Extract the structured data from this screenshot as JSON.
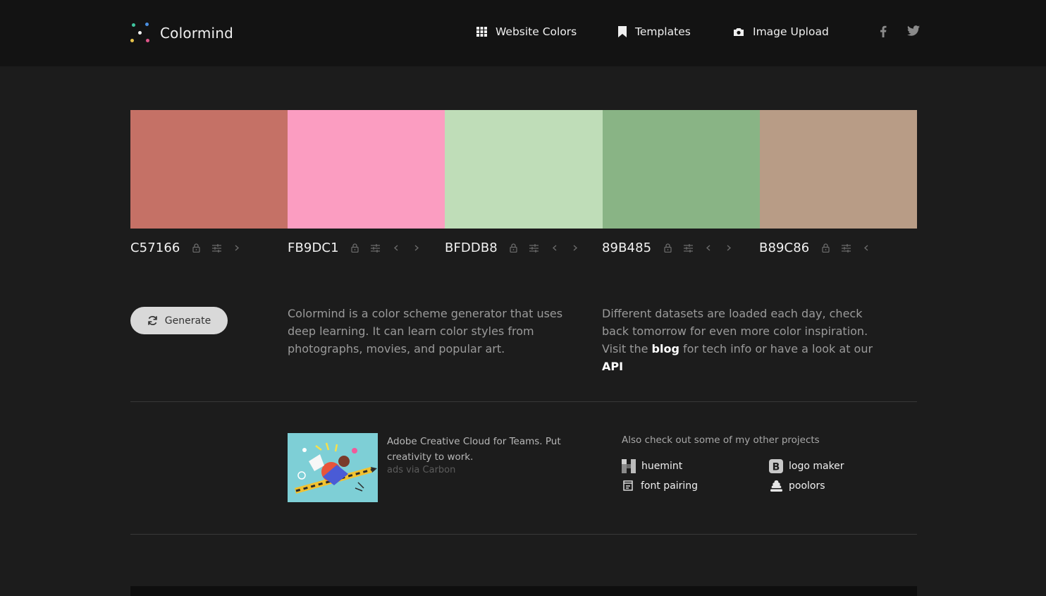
{
  "app": {
    "name": "Colormind"
  },
  "nav": [
    {
      "label": "Website Colors",
      "icon": "grid-icon"
    },
    {
      "label": "Templates",
      "icon": "bookmark-icon"
    },
    {
      "label": "Image Upload",
      "icon": "camera-icon"
    }
  ],
  "social": [
    {
      "icon": "facebook-icon"
    },
    {
      "icon": "twitter-icon"
    }
  ],
  "palette": [
    {
      "hex": "C57166",
      "color": "#C57166"
    },
    {
      "hex": "FB9DC1",
      "color": "#FB9DC1"
    },
    {
      "hex": "BFDDB8",
      "color": "#BFDDB8"
    },
    {
      "hex": "89B485",
      "color": "#89B485"
    },
    {
      "hex": "B89C86",
      "color": "#B89C86"
    }
  ],
  "generate": {
    "label": "Generate"
  },
  "intro": {
    "text": "Colormind is a color scheme generator that uses deep learning. It can learn color styles from photographs, movies, and popular art."
  },
  "datasets": {
    "before": "Different datasets are loaded each day, check back tomorrow for even more color inspiration. Visit the ",
    "blog_link": "blog",
    "middle": " for tech info or have a look at our ",
    "api_link": "API"
  },
  "ad": {
    "text": "Adobe Creative Cloud for Teams. Put creativity to work.",
    "via": "ads via Carbon"
  },
  "projects": {
    "heading": "Also check out some of my other projects",
    "items": [
      {
        "label": "huemint",
        "icon": "huemint-icon"
      },
      {
        "label": "logo maker",
        "icon": "logo-maker-icon"
      },
      {
        "label": "font pairing",
        "icon": "font-pairing-icon"
      },
      {
        "label": "poolors",
        "icon": "poolors-icon"
      }
    ]
  }
}
